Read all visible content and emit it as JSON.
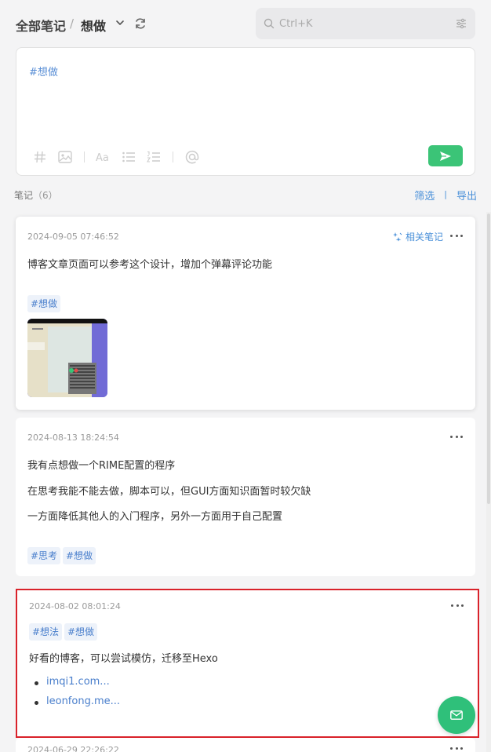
{
  "header": {
    "breadcrumb_root": "全部笔记",
    "breadcrumb_sep": "/",
    "breadcrumb_current": "想做",
    "search_placeholder": "Ctrl+K"
  },
  "editor": {
    "content": "#想做"
  },
  "notes_bar": {
    "label": "笔记",
    "count": "（6）",
    "filter": "筛选",
    "sep": "|",
    "export": "导出"
  },
  "cards": [
    {
      "date": "2024-09-05 07:46:52",
      "related": "相关笔记",
      "lines": [
        "博客文章页面可以参考这个设计，增加个弹幕评论功能"
      ],
      "tags": [
        "#想做"
      ]
    },
    {
      "date": "2024-08-13 18:24:54",
      "lines": [
        "我有点想做一个RIME配置的程序",
        "在思考我能不能去做，脚本可以，但GUI方面知识面暂时较欠缺",
        "一方面降低其他人的入门程序，另外一方面用于自己配置"
      ],
      "tags": [
        "#思考",
        "#想做"
      ]
    },
    {
      "date": "2024-08-02 08:01:24",
      "tags": [
        "#想法",
        "#想做"
      ],
      "lines": [
        "好看的博客，可以尝试模仿，迁移至Hexo"
      ],
      "links": [
        "imqi1.com...",
        "leonfong.me..."
      ]
    },
    {
      "date": "2024-06-29 22:26:22"
    }
  ],
  "colors": {
    "accent": "#4a90d9",
    "send": "#3bc477",
    "highlight": "#d9222a"
  }
}
